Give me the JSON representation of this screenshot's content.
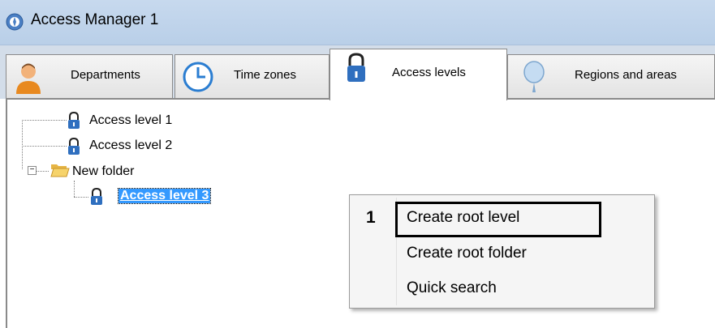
{
  "window": {
    "title": "Access Manager 1",
    "icon": "app-icon"
  },
  "tabs": [
    {
      "label": "Departments",
      "icon": "person-icon",
      "active": false
    },
    {
      "label": "Time zones",
      "icon": "clock-icon",
      "active": false
    },
    {
      "label": "Access levels",
      "icon": "lock-icon",
      "active": true
    },
    {
      "label": "Regions and areas",
      "icon": "balloon-icon",
      "active": false
    }
  ],
  "tree": {
    "items": [
      {
        "label": "Access level 1",
        "icon": "lock-icon"
      },
      {
        "label": "Access level 2",
        "icon": "lock-icon"
      },
      {
        "label": "New folder",
        "icon": "folder-open-icon",
        "expanded": true
      },
      {
        "label": "Access level 3",
        "icon": "lock-icon",
        "selected": true
      }
    ]
  },
  "context_menu": {
    "callout_number": "1",
    "items": [
      {
        "label": "Create root level",
        "highlighted": true
      },
      {
        "label": "Create root folder"
      },
      {
        "label": "Quick search"
      }
    ]
  },
  "colors": {
    "titlebar": "#c7d9ee",
    "selection": "#3399ff",
    "lock_body": "#2f6fbf",
    "menu_bg": "#f5f5f5"
  }
}
